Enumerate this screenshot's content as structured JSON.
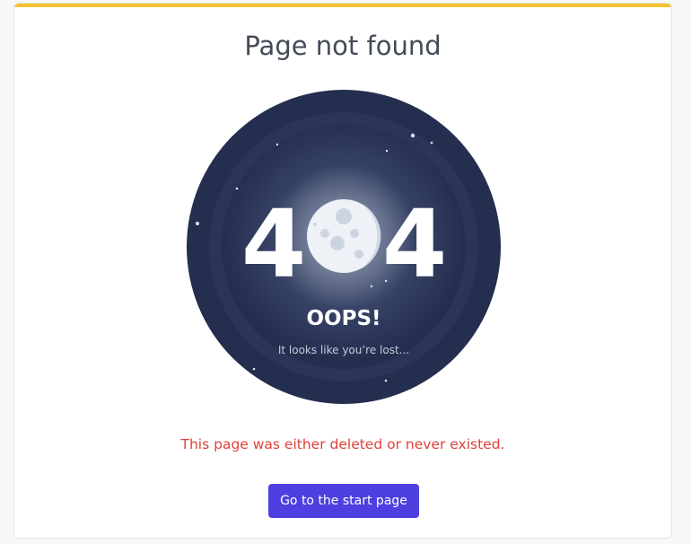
{
  "page": {
    "title": "Page not found",
    "message": "This page was either deleted or never existed."
  },
  "illustration": {
    "code_left": "4",
    "code_right": "4",
    "headline": "OOPS!",
    "subline": "It looks like you’re lost..."
  },
  "actions": {
    "start_page_label": "Go to the start page"
  },
  "colors": {
    "accent_bar": "#f7c12e",
    "title_text": "#434b58",
    "error_text": "#e0413a",
    "button_bg": "#4d3fe0",
    "circle_dark": "#242e4f",
    "circle_light": "#7c8aab"
  },
  "icons": [
    "moon-icon",
    "star-icon"
  ]
}
